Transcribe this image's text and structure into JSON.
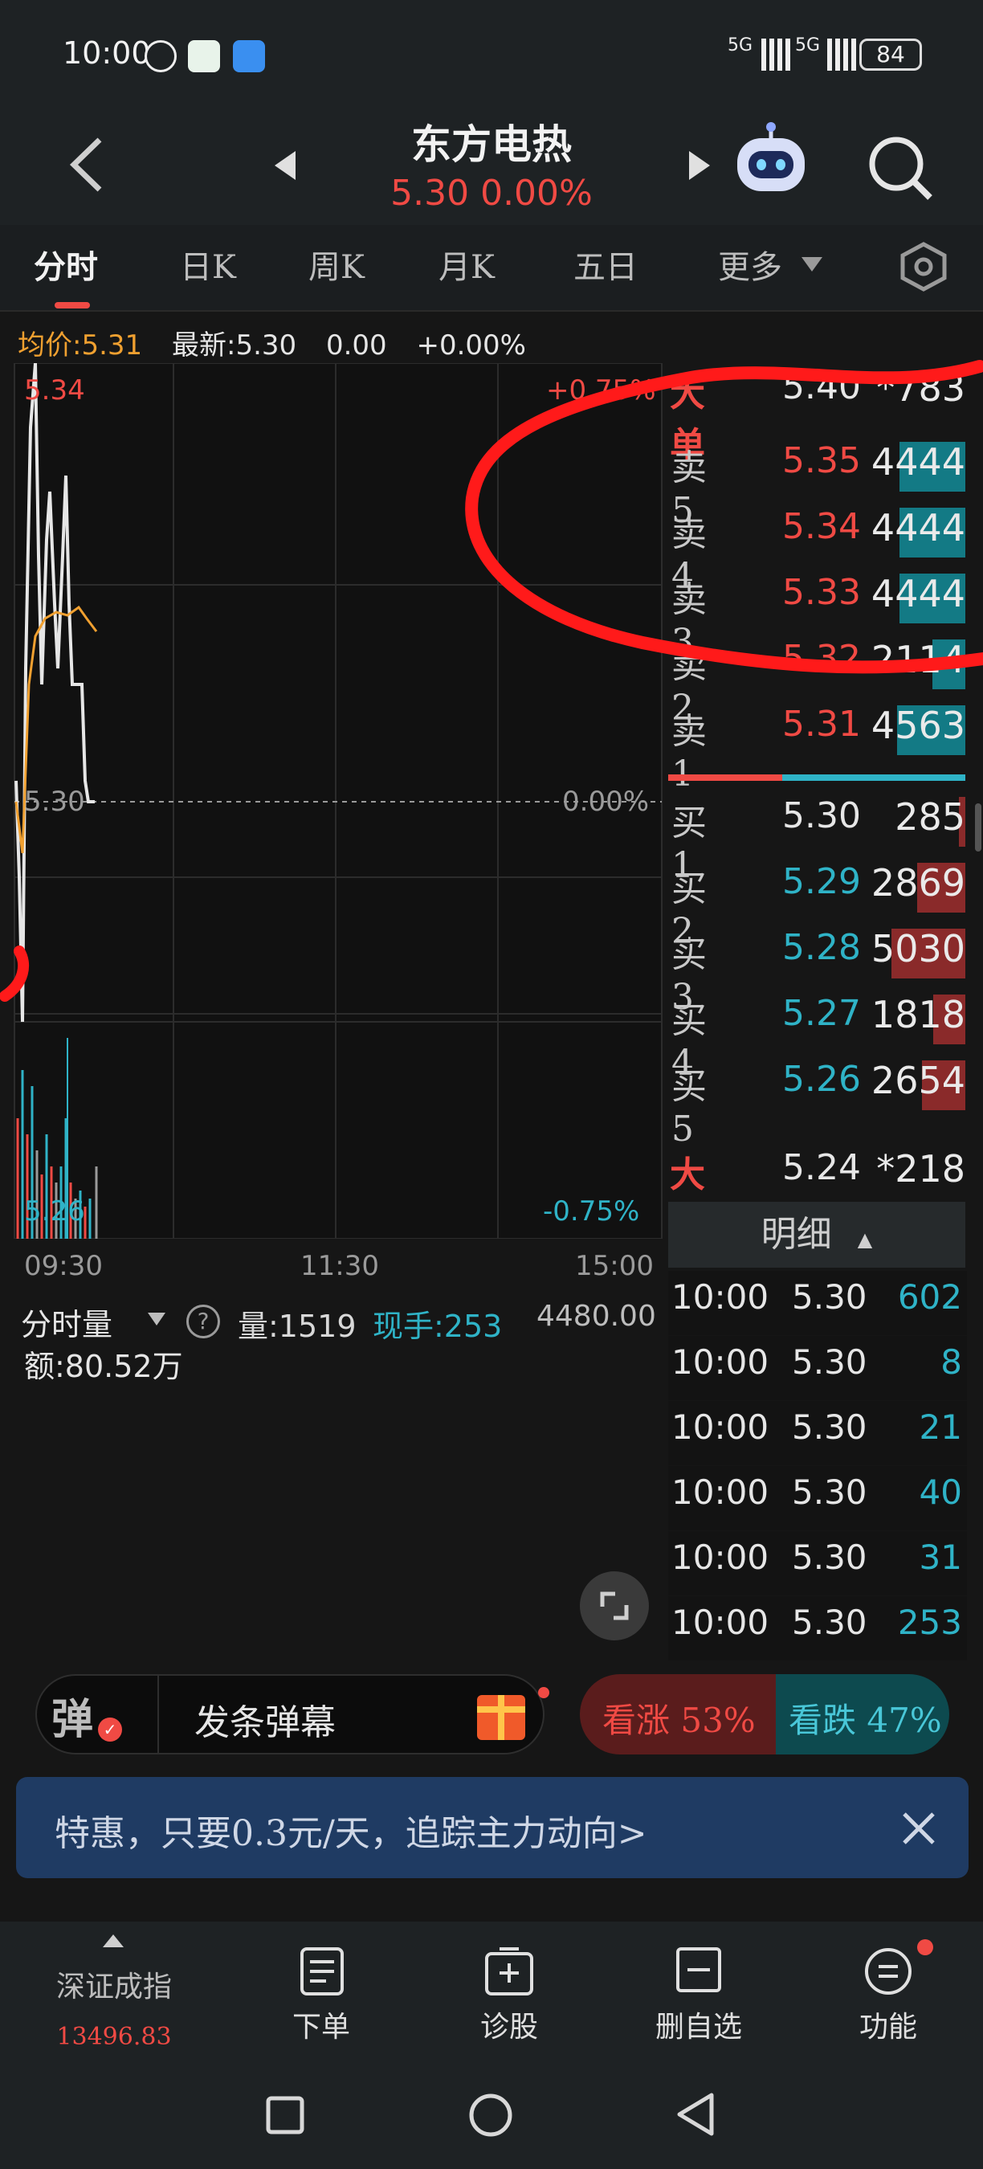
{
  "status_bar": {
    "time": "10:00",
    "battery": "84",
    "signal1": "5G",
    "signal2": "5G"
  },
  "header": {
    "stock_name": "东方电热",
    "price_line": "5.30 0.00%"
  },
  "tabs": [
    "分时",
    "日K",
    "周K",
    "月K",
    "五日",
    "更多"
  ],
  "info_line": {
    "avg": "均价:5.31",
    "latest": "最新:5.30",
    "change": "0.00",
    "percent": "+0.00%"
  },
  "chart": {
    "y_top": "5.34",
    "y_mid": "5.30",
    "y_bottom": "5.26",
    "pct_top": "+0.75%",
    "pct_mid": "0.00%",
    "pct_bottom": "-0.75%",
    "x_labels": [
      "09:30",
      "11:30",
      "15:00"
    ],
    "volume": {
      "selector": "分时量",
      "help": "?",
      "qty": "量:1519",
      "hand": "现手:253",
      "max": "4480.00",
      "amount": "额:80.52万"
    }
  },
  "order_book": {
    "big_sell": {
      "label": "大单",
      "price": "5.40",
      "vol": "*783"
    },
    "asks": [
      {
        "label": "卖5",
        "price": "5.35",
        "vol": "4444",
        "fill": 0.7
      },
      {
        "label": "卖4",
        "price": "5.34",
        "vol": "4444",
        "fill": 0.7
      },
      {
        "label": "卖3",
        "price": "5.33",
        "vol": "4444",
        "fill": 0.7
      },
      {
        "label": "卖2",
        "price": "5.32",
        "vol": "2114",
        "fill": 0.33
      },
      {
        "label": "卖1",
        "price": "5.31",
        "vol": "4563",
        "fill": 0.72
      }
    ],
    "bids": [
      {
        "label": "买1",
        "price": "5.30",
        "vol": "285",
        "fill": 0.04
      },
      {
        "label": "买2",
        "price": "5.29",
        "vol": "2869",
        "fill": 0.5
      },
      {
        "label": "买3",
        "price": "5.28",
        "vol": "5030",
        "fill": 0.79
      },
      {
        "label": "买4",
        "price": "5.27",
        "vol": "1818",
        "fill": 0.32
      },
      {
        "label": "买5",
        "price": "5.26",
        "vol": "2654",
        "fill": 0.45
      }
    ],
    "big_buy": {
      "label": "大单",
      "price": "5.24",
      "vol": "*218"
    }
  },
  "details": {
    "header": "明细",
    "rows": [
      {
        "time": "10:00",
        "price": "5.30",
        "vol": "602"
      },
      {
        "time": "10:00",
        "price": "5.30",
        "vol": "8"
      },
      {
        "time": "10:00",
        "price": "5.30",
        "vol": "21"
      },
      {
        "time": "10:00",
        "price": "5.30",
        "vol": "40"
      },
      {
        "time": "10:00",
        "price": "5.30",
        "vol": "31"
      },
      {
        "time": "10:00",
        "price": "5.30",
        "vol": "253"
      }
    ]
  },
  "danmu": {
    "badge": "弹",
    "prompt": "发条弹幕"
  },
  "sentiment": {
    "up": "看涨 53%",
    "down": "看跌 47%",
    "up_share": 0.53
  },
  "banner": {
    "text": "特惠，只要0.3元/天，追踪主力动向>"
  },
  "bottom_nav": {
    "index_name": "深证成指",
    "index_value": "13496.83",
    "items": [
      "下单",
      "诊股",
      "删自选",
      "功能"
    ]
  },
  "colors": {
    "red": "#f04a44",
    "cyan": "#2fb3c7",
    "orange": "#f0a030",
    "bg": "#161616"
  }
}
